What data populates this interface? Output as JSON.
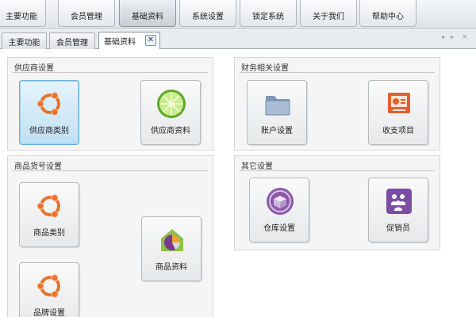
{
  "toolbar": {
    "buttons": [
      {
        "label": "主要功能",
        "active": false
      },
      {
        "label": "会员管理",
        "active": false
      },
      {
        "label": "基础资料",
        "active": true
      },
      {
        "label": "系统设置",
        "active": false
      },
      {
        "label": "锁定系统",
        "active": false
      },
      {
        "label": "关于我们",
        "active": false
      },
      {
        "label": "帮助中心",
        "active": false
      }
    ]
  },
  "tabs": [
    {
      "label": "主要功能",
      "active": false
    },
    {
      "label": "会员管理",
      "active": false
    },
    {
      "label": "基础资料",
      "active": true
    }
  ],
  "tab_close_glyph": "✕",
  "strip_controls": [
    "◂",
    "▸",
    "×"
  ],
  "groups": {
    "supplier": {
      "title": "供应商设置",
      "tiles": [
        {
          "label": "供应商类别",
          "icon": "ubuntu-logo-icon",
          "selected": true
        },
        {
          "label": "供应商资料",
          "icon": "lime-slice-icon",
          "selected": false
        }
      ]
    },
    "finance": {
      "title": "财务相关设置",
      "tiles": [
        {
          "label": "账户设置",
          "icon": "folder-icon",
          "selected": false
        },
        {
          "label": "收支项目",
          "icon": "presentation-icon",
          "selected": false
        }
      ]
    },
    "goods": {
      "title": "商品货号设置",
      "tiles": [
        {
          "label": "商品类别",
          "icon": "ubuntu-logo-icon",
          "selected": false
        },
        {
          "label": "商品资料",
          "icon": "house-pie-icon",
          "selected": false
        },
        {
          "label": "品牌设置",
          "icon": "ubuntu-logo-icon",
          "selected": false
        }
      ]
    },
    "other": {
      "title": "其它设置",
      "tiles": [
        {
          "label": "仓库设置",
          "icon": "warehouse-box-icon",
          "selected": false
        },
        {
          "label": "促销员",
          "icon": "people-group-icon",
          "selected": false
        }
      ]
    }
  },
  "colors": {
    "ubuntu_orange": "#e8742c",
    "lime_green": "#7cc33a",
    "folder_blue": "#8ba6c4",
    "presentation_orange": "#e0622b",
    "warehouse_purple": "#8a5aa8",
    "people_purple": "#7b4ea3",
    "selected_tile": "#bfe0f3"
  }
}
